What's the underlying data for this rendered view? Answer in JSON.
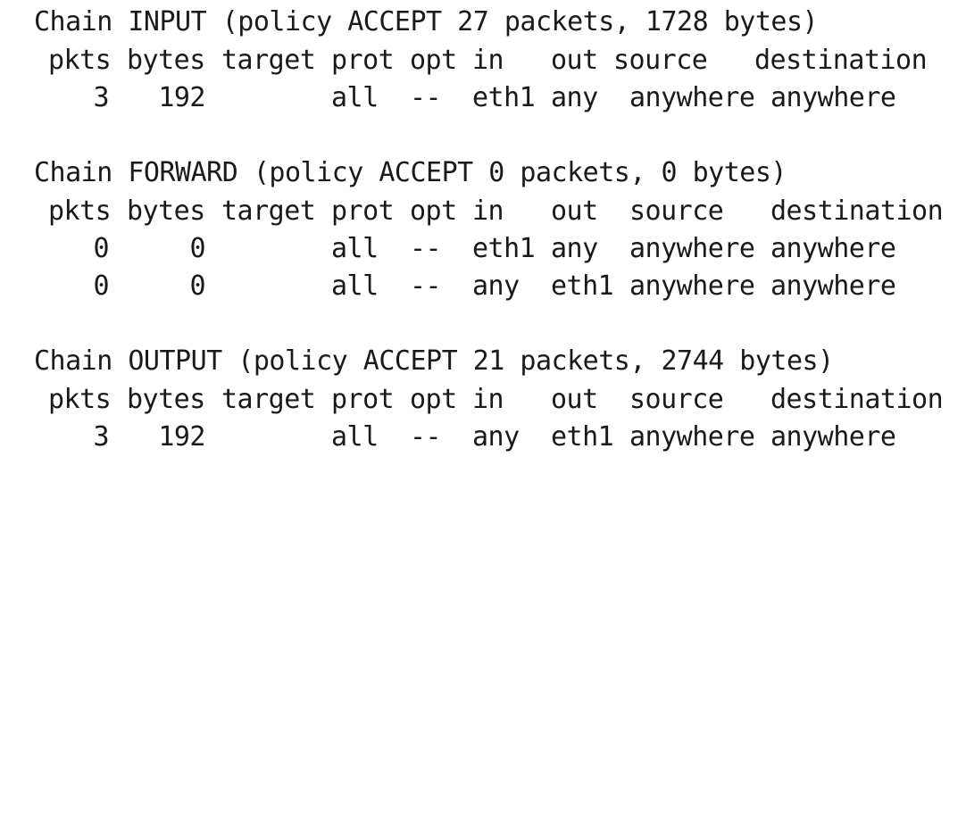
{
  "chains": [
    {
      "title": "Chain INPUT (policy ACCEPT 27 packets, 1728 bytes)",
      "header": [
        "pkts",
        "bytes",
        "target",
        "prot",
        "opt",
        "in",
        "out",
        "source",
        "destination"
      ],
      "rows": [
        [
          "3",
          "192",
          "",
          "all",
          "--",
          "eth1",
          "any",
          "anywhere",
          "anywhere"
        ]
      ]
    },
    {
      "title": "Chain FORWARD (policy ACCEPT 0 packets, 0 bytes)",
      "header": [
        "pkts",
        "bytes",
        "target",
        "prot",
        "opt",
        "in",
        "out",
        "source",
        "destination"
      ],
      "rows": [
        [
          "0",
          "0",
          "",
          "all",
          "--",
          "eth1",
          "any",
          "anywhere",
          "anywhere"
        ],
        [
          "0",
          "0",
          "",
          "all",
          "--",
          "any",
          "eth1",
          "anywhere",
          "anywhere"
        ]
      ]
    },
    {
      "title": "Chain OUTPUT (policy ACCEPT 21 packets, 2744 bytes)",
      "header": [
        "pkts",
        "bytes",
        "target",
        "prot",
        "opt",
        "in",
        "out",
        "source",
        "destination"
      ],
      "rows": [
        [
          "3",
          "192",
          "",
          "all",
          "--",
          "any",
          "eth1",
          "anywhere",
          "anywhere"
        ]
      ]
    }
  ]
}
